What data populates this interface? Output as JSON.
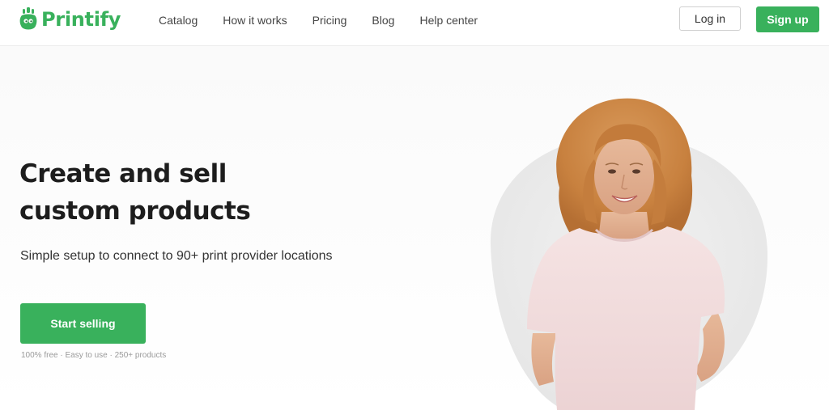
{
  "brand": {
    "name": "Printify",
    "color": "#39b15c"
  },
  "nav": {
    "items": [
      {
        "label": "Catalog"
      },
      {
        "label": "How it works"
      },
      {
        "label": "Pricing"
      },
      {
        "label": "Blog"
      },
      {
        "label": "Help center"
      }
    ]
  },
  "auth": {
    "login_label": "Log in",
    "signup_label": "Sign up"
  },
  "hero": {
    "headline_line1": "Create and sell",
    "headline_line2": "custom products",
    "subheadline": "Simple setup to connect to 90+ print provider locations",
    "cta_label": "Start selling",
    "features_text": "100% free · Easy to use · 250+ products",
    "image": "woman-in-pink-tshirt-photo"
  }
}
